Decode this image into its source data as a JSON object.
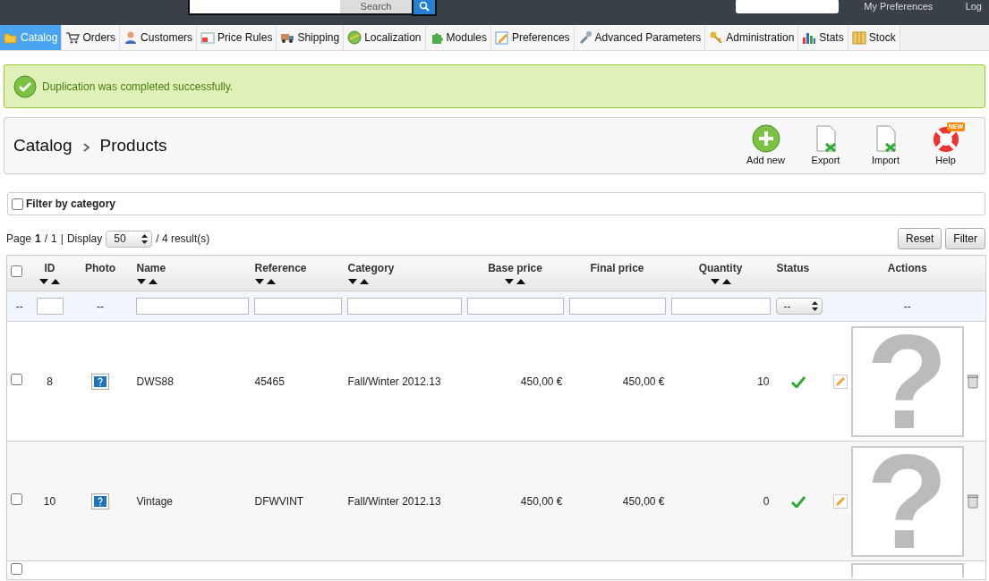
{
  "header": {
    "search_button": "Search",
    "preferences_link": "My Preferences",
    "logout_link": "Log"
  },
  "tabs": [
    {
      "label": "Catalog",
      "selected": true
    },
    {
      "label": "Orders",
      "selected": false
    },
    {
      "label": "Customers",
      "selected": false
    },
    {
      "label": "Price Rules",
      "selected": false
    },
    {
      "label": "Shipping",
      "selected": false
    },
    {
      "label": "Localization",
      "selected": false
    },
    {
      "label": "Modules",
      "selected": false
    },
    {
      "label": "Preferences",
      "selected": false
    },
    {
      "label": "Advanced Parameters",
      "selected": false
    },
    {
      "label": "Administration",
      "selected": false
    },
    {
      "label": "Stats",
      "selected": false
    },
    {
      "label": "Stock",
      "selected": false
    }
  ],
  "alert": "Duplication was completed successfully.",
  "breadcrumb": [
    "Catalog",
    "Products"
  ],
  "toolbar": [
    {
      "label": "Add new"
    },
    {
      "label": "Export"
    },
    {
      "label": "Import"
    },
    {
      "label": "Help",
      "badge": "NEW"
    }
  ],
  "category_filter": {
    "label": "Filter by category",
    "checked": false
  },
  "pagination": {
    "page_label": "Page",
    "page": "1",
    "separator": "/",
    "pages": "1",
    "pipe": "|",
    "display_label": "Display",
    "per_page": "50",
    "results": "/ 4 result(s)"
  },
  "select_all": {
    "checked": false
  },
  "buttons": [
    "Reset",
    "Filter"
  ],
  "table": {
    "columns": [
      {
        "label": "ID",
        "sortable": true
      },
      {
        "label": "Photo",
        "sortable": false
      },
      {
        "label": "Name",
        "sortable": true
      },
      {
        "label": "Reference",
        "sortable": true
      },
      {
        "label": "Category",
        "sortable": true
      },
      {
        "label": "Base price",
        "sortable": true
      },
      {
        "label": "Final price",
        "sortable": false
      },
      {
        "label": "Quantity",
        "sortable": true
      },
      {
        "label": "Status",
        "sortable": false
      },
      {
        "label": "Actions",
        "sortable": false
      }
    ],
    "filters": [
      {
        "kind": "dash",
        "text": "--"
      },
      {
        "kind": "input"
      },
      {
        "kind": "dash",
        "text": "--"
      },
      {
        "kind": "input"
      },
      {
        "kind": "input"
      },
      {
        "kind": "input"
      },
      {
        "kind": "input"
      },
      {
        "kind": "input"
      },
      {
        "kind": "input"
      },
      {
        "kind": "select",
        "value": "--"
      },
      {
        "kind": "dash",
        "text": "--"
      }
    ],
    "rows": [
      {
        "checked": false,
        "id": "8",
        "name": "DWS88",
        "reference": "45465",
        "category": "Fall/Winter 2012.13",
        "base_price": "450,00 €",
        "final_price": "450,00 €",
        "quantity": "10",
        "active": true,
        "preview": "?"
      },
      {
        "checked": false,
        "id": "10",
        "name": "Vintage",
        "reference": "DFWVINT",
        "category": "Fall/Winter 2012.13",
        "base_price": "450,00 €",
        "final_price": "450,00 €",
        "quantity": "0",
        "active": true,
        "preview": "?"
      },
      {
        "checked": false
      }
    ]
  }
}
